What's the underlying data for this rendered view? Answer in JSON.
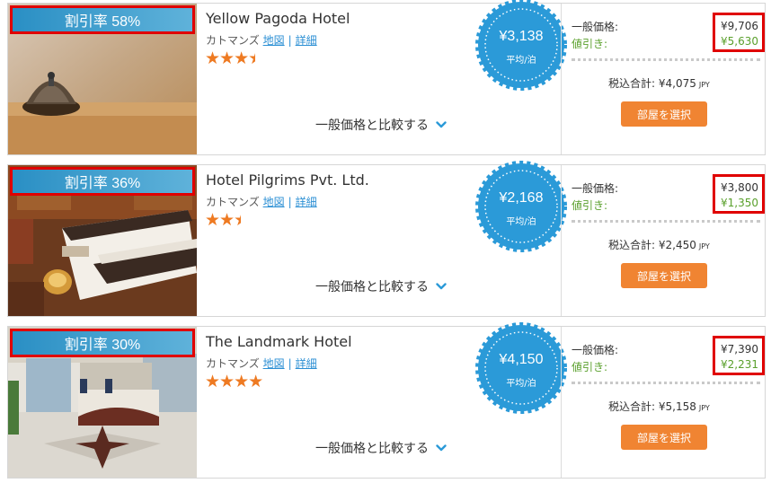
{
  "hotels": [
    {
      "discount": "割引率 58%",
      "name": "Yellow Pagoda Hotel",
      "city": "カトマンズ",
      "map_link": "地図",
      "details_link": "詳細",
      "stars": 3.5,
      "compare_label": "一般価格と比較する",
      "price": "¥3,138",
      "per_night": "平均/泊",
      "regular_label": "一般価格:",
      "discount_label": "値引き:",
      "regular_price": "¥9,706",
      "discount_amount": "¥5,630",
      "total_label": "税込合計: ¥4,075",
      "total_currency": "JPY",
      "select_button": "部屋を選択"
    },
    {
      "discount": "割引率 36%",
      "name": "Hotel Pilgrims Pvt. Ltd.",
      "city": "カトマンズ",
      "map_link": "地図",
      "details_link": "詳細",
      "stars": 2.5,
      "compare_label": "一般価格と比較する",
      "price": "¥2,168",
      "per_night": "平均/泊",
      "regular_label": "一般価格:",
      "discount_label": "値引き:",
      "regular_price": "¥3,800",
      "discount_amount": "¥1,350",
      "total_label": "税込合計: ¥2,450",
      "total_currency": "JPY",
      "select_button": "部屋を選択"
    },
    {
      "discount": "割引率 30%",
      "name": "The Landmark Hotel",
      "city": "カトマンズ",
      "map_link": "地図",
      "details_link": "詳細",
      "stars": 4,
      "compare_label": "一般価格と比較する",
      "price": "¥4,150",
      "per_night": "平均/泊",
      "regular_label": "一般価格:",
      "discount_label": "値引き:",
      "regular_price": "¥7,390",
      "discount_amount": "¥2,231",
      "total_label": "税込合計: ¥5,158",
      "total_currency": "JPY",
      "select_button": "部屋を選択"
    }
  ],
  "colors": {
    "accent_blue": "#2b9ad8",
    "button_orange": "#f08432",
    "star_orange": "#ee7a22",
    "discount_green": "#5aa02c",
    "highlight_red": "#e00000"
  },
  "icons": {
    "compare_toggle": "chevron-down-icon",
    "star": "star-icon"
  }
}
